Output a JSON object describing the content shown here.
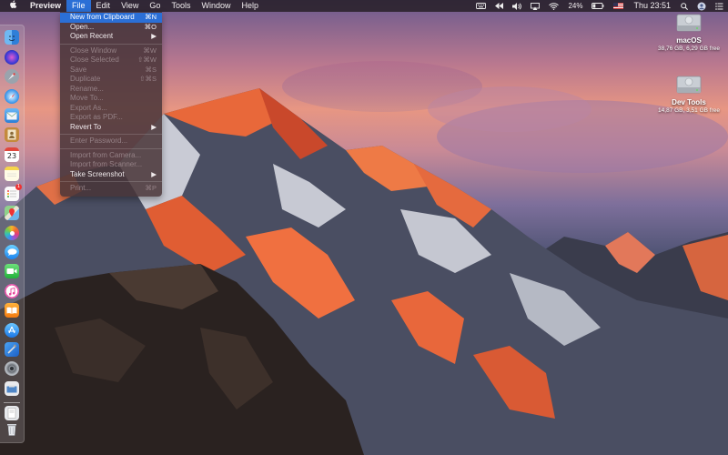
{
  "menubar": {
    "app_name": "Preview",
    "menus": [
      "File",
      "Edit",
      "View",
      "Go",
      "Tools",
      "Window",
      "Help"
    ],
    "battery": "24%",
    "clock": "Thu 23:51"
  },
  "file_menu": {
    "items": [
      {
        "label": "New from Clipboard",
        "shortcut": "⌘N"
      },
      {
        "label": "Open...",
        "shortcut": "⌘O"
      },
      {
        "label": "Open Recent",
        "shortcut": "▶"
      },
      {
        "label": "Close Window",
        "shortcut": "⌘W"
      },
      {
        "label": "Close Selected",
        "shortcut": "⇧⌘W"
      },
      {
        "label": "Save",
        "shortcut": "⌘S"
      },
      {
        "label": "Duplicate",
        "shortcut": "⇧⌘S"
      },
      {
        "label": "Rename...",
        "shortcut": ""
      },
      {
        "label": "Move To...",
        "shortcut": ""
      },
      {
        "label": "Export As...",
        "shortcut": ""
      },
      {
        "label": "Export as PDF...",
        "shortcut": ""
      },
      {
        "label": "Revert To",
        "shortcut": "▶"
      },
      {
        "label": "Enter Password...",
        "shortcut": ""
      },
      {
        "label": "Import from Camera...",
        "shortcut": ""
      },
      {
        "label": "Import from Scanner...",
        "shortcut": ""
      },
      {
        "label": "Take Screenshot",
        "shortcut": "▶"
      },
      {
        "label": "Print...",
        "shortcut": "⌘P"
      }
    ]
  },
  "dock": {
    "calendar_day": "23",
    "reminders_badge": "1"
  },
  "desktop": {
    "drives": [
      {
        "name": "macOS",
        "info": "38,76 GB, 6,29 GB free"
      },
      {
        "name": "Dev Tools",
        "info": "14,87 GB, 3,51 GB free"
      }
    ]
  },
  "colors": {
    "selection": "#2b6fd6",
    "menubar": "#231c22"
  }
}
